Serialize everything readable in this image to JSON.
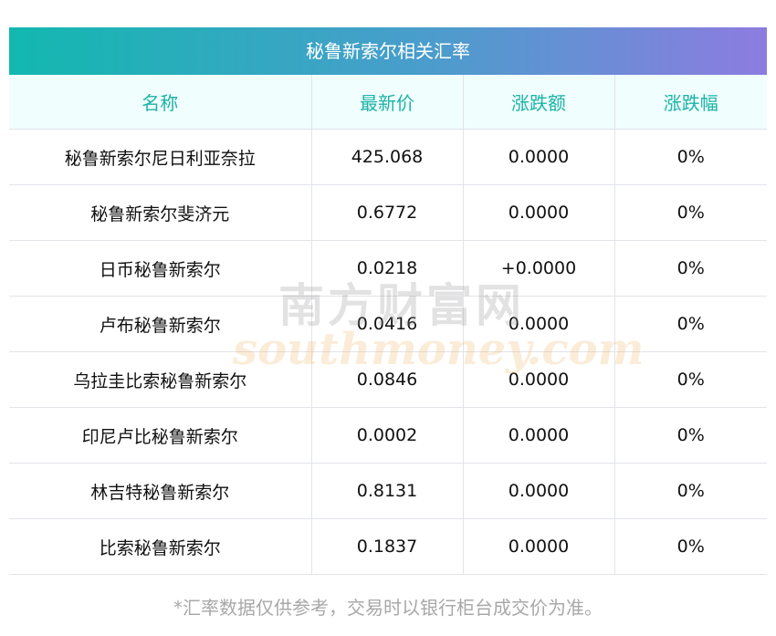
{
  "title": "秘鲁新索尔相关汇率",
  "columns": [
    "名称",
    "最新价",
    "涨跌额",
    "涨跌幅"
  ],
  "rows": [
    {
      "name": "秘鲁新索尔尼日利亚奈拉",
      "price": "425.068",
      "change": "0.0000",
      "pct": "0%"
    },
    {
      "name": "秘鲁新索尔斐济元",
      "price": "0.6772",
      "change": "0.0000",
      "pct": "0%"
    },
    {
      "name": "日币秘鲁新索尔",
      "price": "0.0218",
      "change": "+0.0000",
      "pct": "0%"
    },
    {
      "name": "卢布秘鲁新索尔",
      "price": "0.0416",
      "change": "0.0000",
      "pct": "0%"
    },
    {
      "name": "乌拉圭比索秘鲁新索尔",
      "price": "0.0846",
      "change": "0.0000",
      "pct": "0%"
    },
    {
      "name": "印尼卢比秘鲁新索尔",
      "price": "0.0002",
      "change": "0.0000",
      "pct": "0%"
    },
    {
      "name": "林吉特秘鲁新索尔",
      "price": "0.8131",
      "change": "0.0000",
      "pct": "0%"
    },
    {
      "name": "比索秘鲁新索尔",
      "price": "0.1837",
      "change": "0.0000",
      "pct": "0%"
    }
  ],
  "footer": "*汇率数据仅供参考，交易时以银行柜台成交价为准。",
  "watermark": {
    "cn": "南方财富网",
    "en": "southmoney.com"
  }
}
